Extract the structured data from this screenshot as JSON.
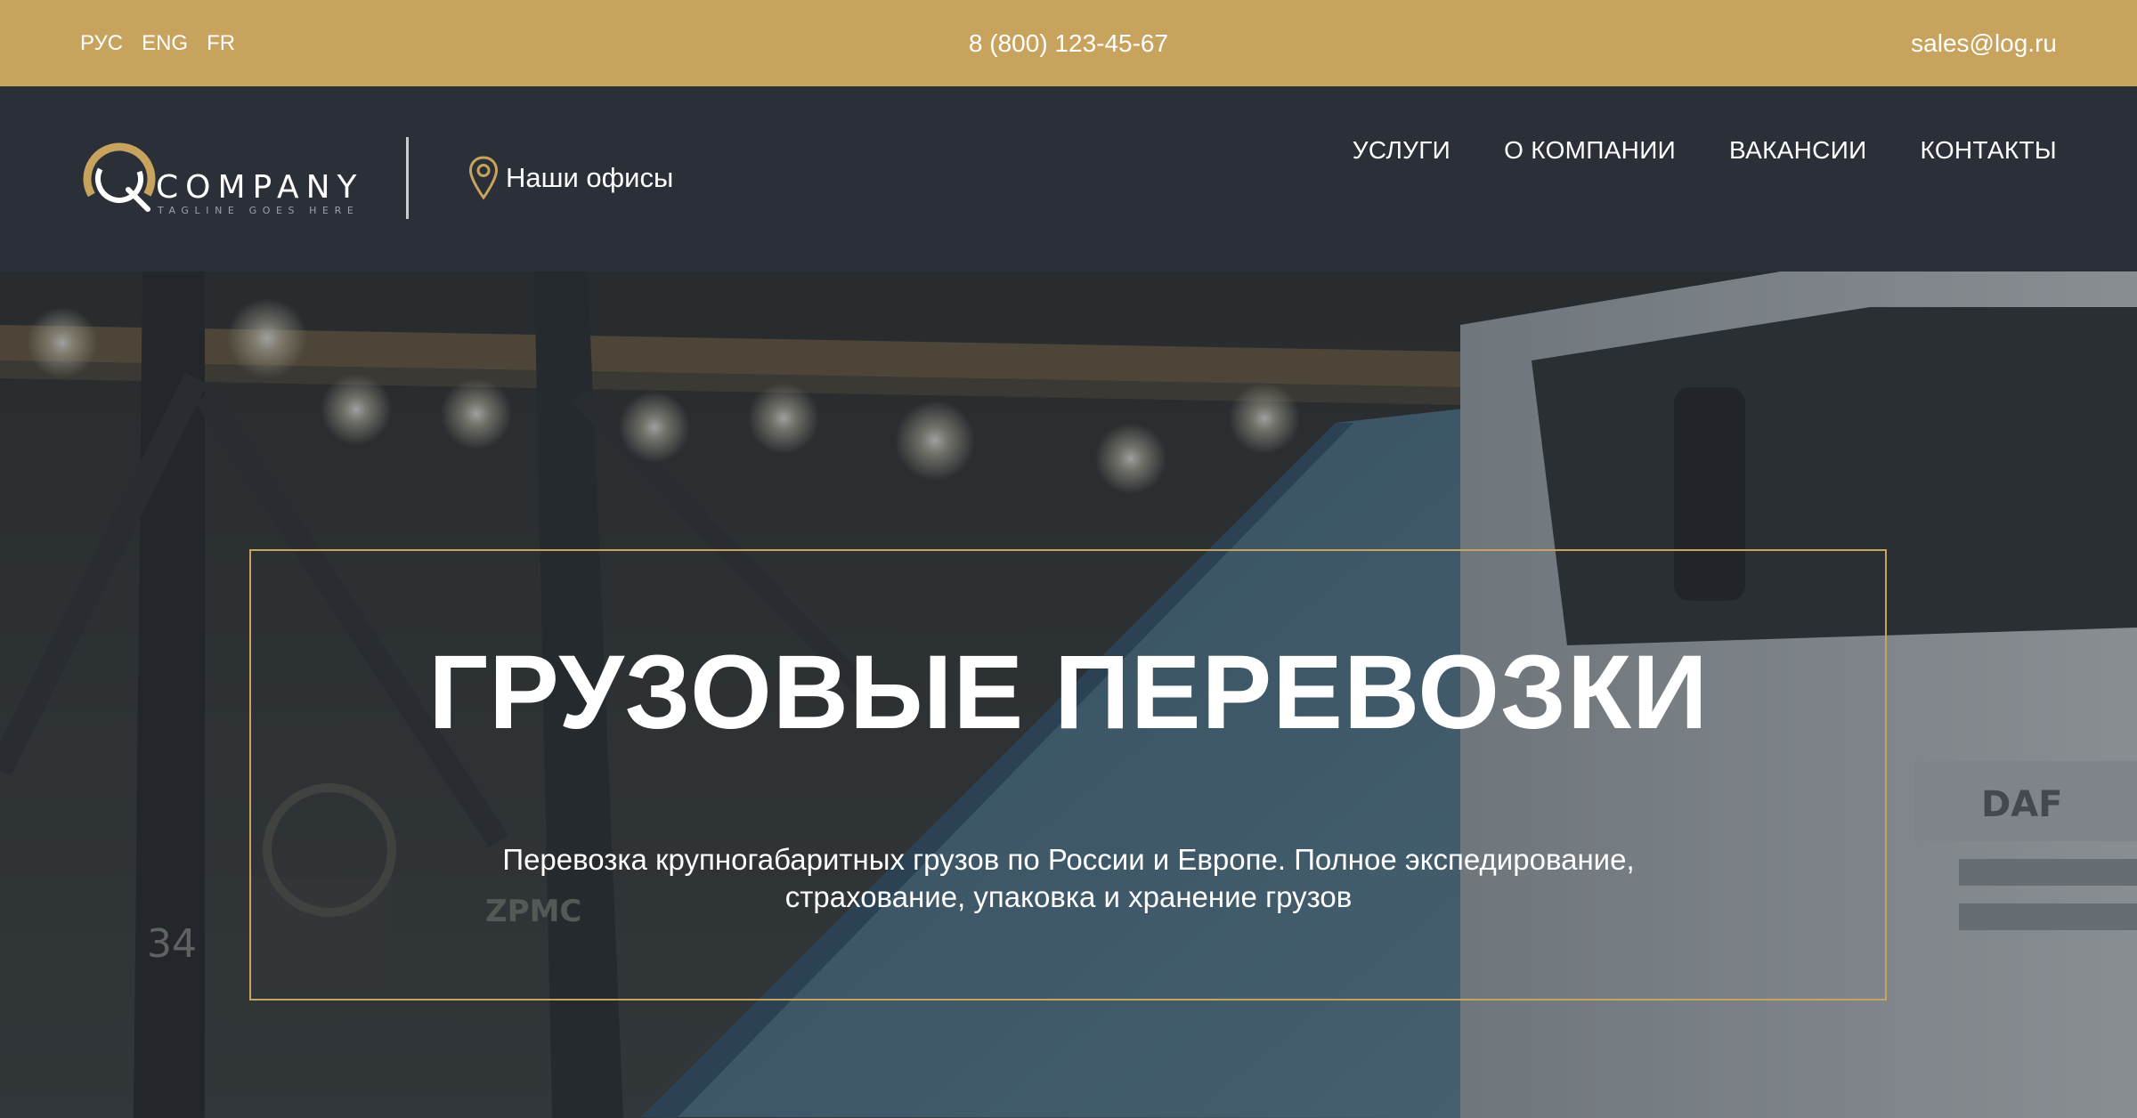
{
  "topbar": {
    "languages": [
      "РУС",
      "ENG",
      "FR"
    ],
    "phone": "8 (800) 123-45-67",
    "email": "sales@log.ru",
    "background_color": "#c8a35e"
  },
  "header": {
    "logo": {
      "name": "COMPANY",
      "tagline": "TAGLINE GOES HERE",
      "accent_color": "#c8a35e"
    },
    "offices_link": "Наши офисы",
    "nav": [
      "УСЛУГИ",
      "О КОМПАНИИ",
      "ВАКАНСИИ",
      "КОНТАКТЫ"
    ],
    "background_color": "#2b2f38"
  },
  "hero": {
    "title": "ГРУЗОВЫЕ ПЕРЕВОЗКИ",
    "subtitle_line1": "Перевозка крупногабаритных грузов по России и Европе. Полное экспедирование,",
    "subtitle_line2": "страхование, упаковка и хранение грузов",
    "frame_color": "#c8a35e",
    "background_scene": {
      "truck_badge": "DAF",
      "crane_mark": "ZPMC",
      "crane_number": "34"
    }
  }
}
